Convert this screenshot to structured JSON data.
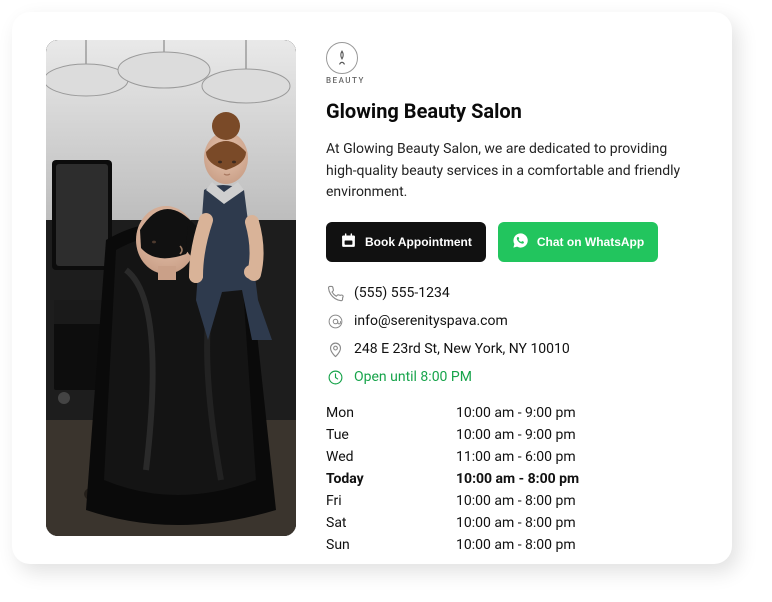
{
  "logo": {
    "tag": "BEAUTY"
  },
  "title": "Glowing Beauty Salon",
  "description": "At Glowing Beauty Salon, we are dedicated to providing high-quality beauty services in a comfortable and friendly environment.",
  "buttons": {
    "book": "Book Appointment",
    "whatsapp": "Chat on WhatsApp"
  },
  "contact": {
    "phone": "(555) 555-1234",
    "email": "info@serenityspava.com",
    "address": "248 E 23rd St, New York, NY 10010",
    "open": "Open until 8:00 PM"
  },
  "hours": [
    {
      "day": "Mon",
      "time": "10:00 am - 9:00 pm",
      "today": false
    },
    {
      "day": "Tue",
      "time": "10:00 am - 9:00 pm",
      "today": false
    },
    {
      "day": "Wed",
      "time": "11:00 am - 6:00 pm",
      "today": false
    },
    {
      "day": "Today",
      "time": "10:00 am - 8:00 pm",
      "today": true
    },
    {
      "day": "Fri",
      "time": "10:00 am - 8:00 pm",
      "today": false
    },
    {
      "day": "Sat",
      "time": "10:00 am - 8:00 pm",
      "today": false
    },
    {
      "day": "Sun",
      "time": "10:00 am - 8:00 pm",
      "today": false
    }
  ]
}
